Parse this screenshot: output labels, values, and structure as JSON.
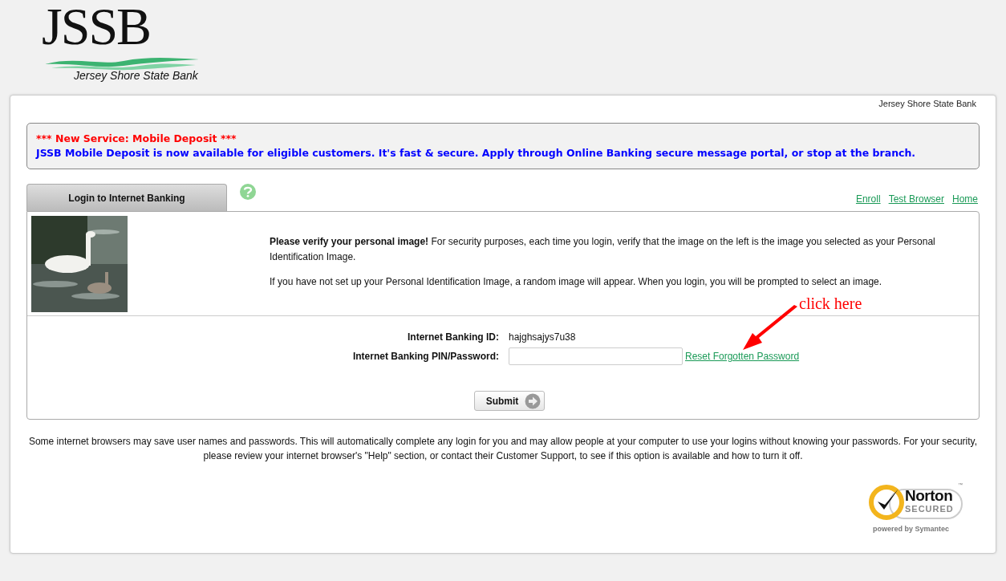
{
  "logo": {
    "mark": "JSSB",
    "name": "Jersey Shore State Bank"
  },
  "bank_name": "Jersey Shore State Bank",
  "notice": {
    "title": "*** New Service: Mobile Deposit ***",
    "body": "JSSB Mobile Deposit is now available for eligible customers. It's fast & secure. Apply through Online Banking secure message portal, or stop at the branch."
  },
  "tabs": [
    {
      "label": "Login to Internet Banking",
      "selected": true
    }
  ],
  "links": [
    "Enroll",
    "Test Browser",
    "Home"
  ],
  "personal_image": {
    "kind": "picture"
  },
  "verify_text": [
    "**Please verify your personal image!** For security purposes, each time you login, verify that the image on the left is the image you selected as your Personal Identification Image.",
    "If you have not set up your Personal Identification Image, a random image will appear. When you login, you will be prompted to select an image."
  ],
  "form": {
    "id_label": "Internet Banking ID:",
    "id_value": "hajghsajys7u38",
    "pin_label": "Internet Banking PIN/Password:",
    "reset_link": "Reset Forgotten Password",
    "submit": "Submit"
  },
  "annotation": "click here",
  "footer": "Some internet browsers may save user names and passwords. This will automatically complete any login for you and may allow people at your computer to use your logins without knowing your passwords. For your security, please review your internet browser's \"Help\" section, or contact their Customer Support, to see if this option is available and how to turn it off.",
  "norton": {
    "brand": "Norton",
    "status": "SECURED",
    "tm": "™",
    "powered": "powered by Symantec"
  }
}
